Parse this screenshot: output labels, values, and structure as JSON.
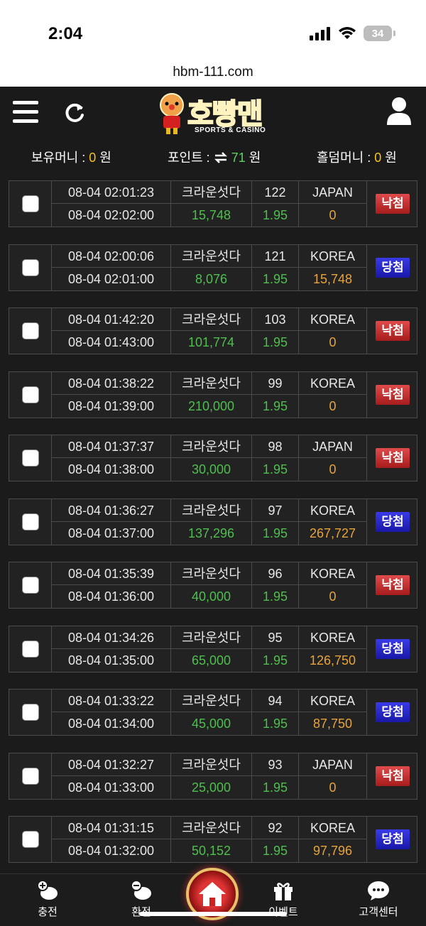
{
  "status": {
    "time": "2:04",
    "battery": "34"
  },
  "url": "hbm-111.com",
  "logo": {
    "name": "호빵맨",
    "sub": "SPORTS & CASINO"
  },
  "money": {
    "holding_label": "보유머니 : ",
    "holding_value": "0",
    "holding_unit": " 원",
    "point_label": "포인트 : ",
    "point_value": "71",
    "point_unit": " 원",
    "holdem_label": "홀덤머니 : ",
    "holdem_value": "0",
    "holdem_unit": " 원"
  },
  "bets": [
    {
      "bet_time": "08-04 02:01:23",
      "game_time": "08-04 02:02:00",
      "game": "크라운섯다",
      "round": "122",
      "pick": "JAPAN",
      "amount": "15,748",
      "odds": "1.95",
      "payout": "0",
      "result": "낙첨",
      "status": "lose"
    },
    {
      "bet_time": "08-04 02:00:06",
      "game_time": "08-04 02:01:00",
      "game": "크라운섯다",
      "round": "121",
      "pick": "KOREA",
      "amount": "8,076",
      "odds": "1.95",
      "payout": "15,748",
      "result": "당첨",
      "status": "win"
    },
    {
      "bet_time": "08-04 01:42:20",
      "game_time": "08-04 01:43:00",
      "game": "크라운섯다",
      "round": "103",
      "pick": "KOREA",
      "amount": "101,774",
      "odds": "1.95",
      "payout": "0",
      "result": "낙첨",
      "status": "lose"
    },
    {
      "bet_time": "08-04 01:38:22",
      "game_time": "08-04 01:39:00",
      "game": "크라운섯다",
      "round": "99",
      "pick": "KOREA",
      "amount": "210,000",
      "odds": "1.95",
      "payout": "0",
      "result": "낙첨",
      "status": "lose"
    },
    {
      "bet_time": "08-04 01:37:37",
      "game_time": "08-04 01:38:00",
      "game": "크라운섯다",
      "round": "98",
      "pick": "JAPAN",
      "amount": "30,000",
      "odds": "1.95",
      "payout": "0",
      "result": "낙첨",
      "status": "lose"
    },
    {
      "bet_time": "08-04 01:36:27",
      "game_time": "08-04 01:37:00",
      "game": "크라운섯다",
      "round": "97",
      "pick": "KOREA",
      "amount": "137,296",
      "odds": "1.95",
      "payout": "267,727",
      "result": "당첨",
      "status": "win"
    },
    {
      "bet_time": "08-04 01:35:39",
      "game_time": "08-04 01:36:00",
      "game": "크라운섯다",
      "round": "96",
      "pick": "KOREA",
      "amount": "40,000",
      "odds": "1.95",
      "payout": "0",
      "result": "낙첨",
      "status": "lose"
    },
    {
      "bet_time": "08-04 01:34:26",
      "game_time": "08-04 01:35:00",
      "game": "크라운섯다",
      "round": "95",
      "pick": "KOREA",
      "amount": "65,000",
      "odds": "1.95",
      "payout": "126,750",
      "result": "당첨",
      "status": "win"
    },
    {
      "bet_time": "08-04 01:33:22",
      "game_time": "08-04 01:34:00",
      "game": "크라운섯다",
      "round": "94",
      "pick": "KOREA",
      "amount": "45,000",
      "odds": "1.95",
      "payout": "87,750",
      "result": "당첨",
      "status": "win"
    },
    {
      "bet_time": "08-04 01:32:27",
      "game_time": "08-04 01:33:00",
      "game": "크라운섯다",
      "round": "93",
      "pick": "JAPAN",
      "amount": "25,000",
      "odds": "1.95",
      "payout": "0",
      "result": "낙첨",
      "status": "lose"
    },
    {
      "bet_time": "08-04 01:31:15",
      "game_time": "08-04 01:32:00",
      "game": "크라운섯다",
      "round": "92",
      "pick": "KOREA",
      "amount": "50,152",
      "odds": "1.95",
      "payout": "97,796",
      "result": "당첨",
      "status": "win"
    }
  ],
  "nav": [
    {
      "label": "충전",
      "icon": "charge-icon"
    },
    {
      "label": "환전",
      "icon": "exchange-icon"
    },
    {
      "label": "",
      "icon": "home-icon"
    },
    {
      "label": "이벤트",
      "icon": "gift-icon"
    },
    {
      "label": "고객센터",
      "icon": "support-icon"
    }
  ]
}
